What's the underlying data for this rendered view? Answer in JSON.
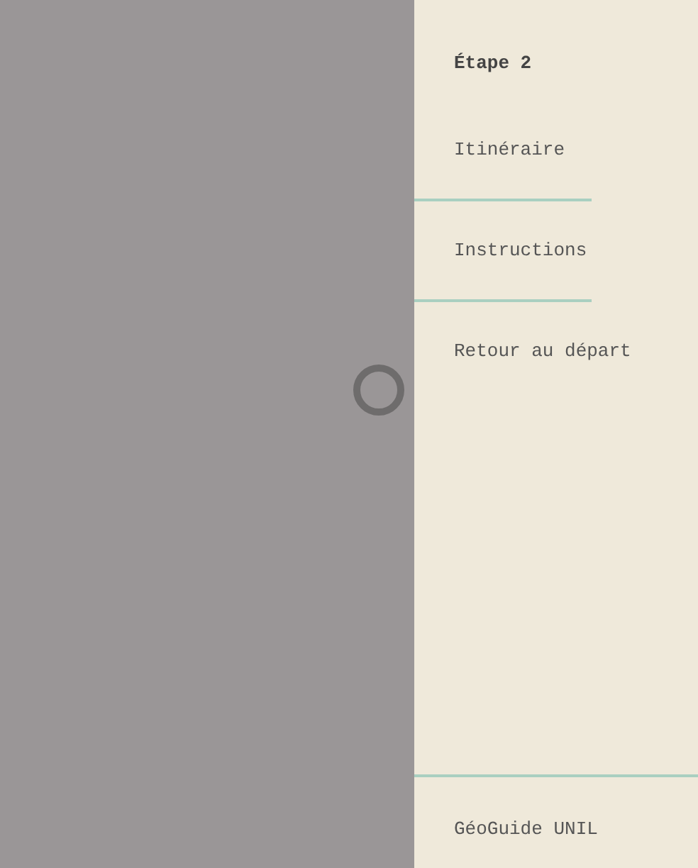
{
  "menu": {
    "title": "Étape 2",
    "items": [
      {
        "label": "Itinéraire"
      },
      {
        "label": "Instructions"
      },
      {
        "label": "Retour au départ"
      }
    ],
    "footer": "GéoGuide UNIL"
  }
}
